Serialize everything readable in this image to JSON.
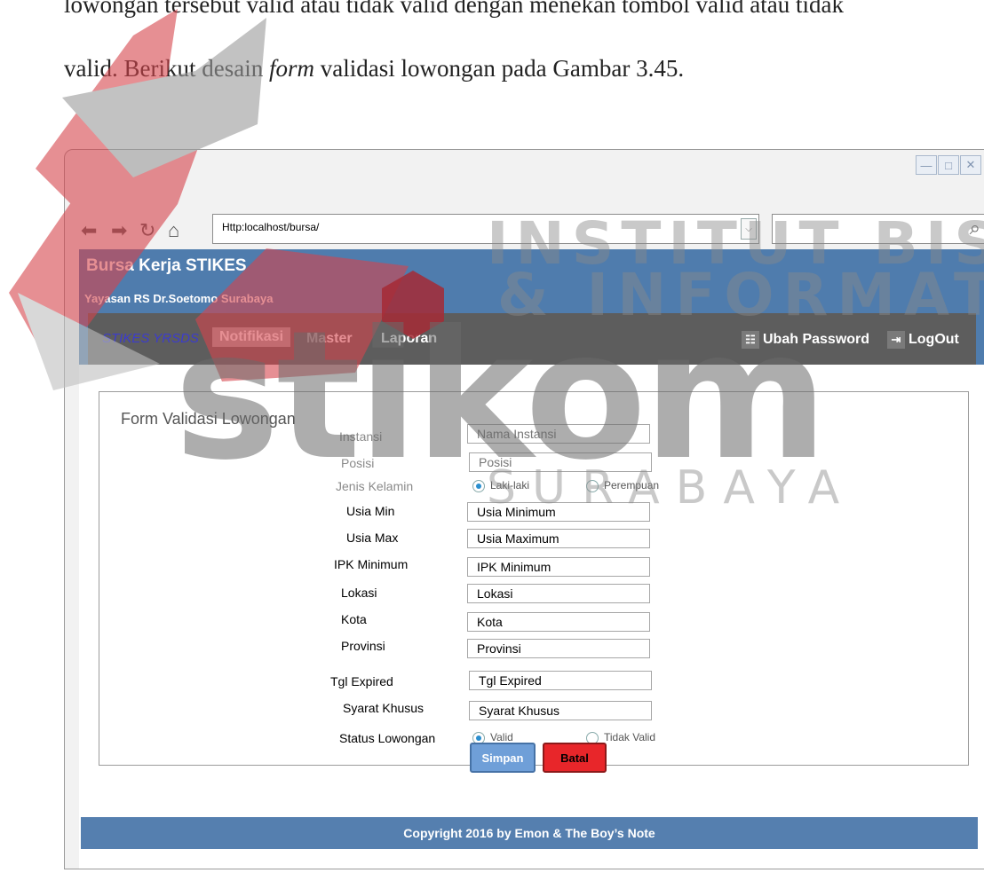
{
  "document": {
    "line1": "lowongan tersebut valid atau tidak valid dengan menekan tombol valid atau tidak",
    "line2_before_italic": "valid. Berikut desain ",
    "line2_italic": "form",
    "line2_after_italic": " validasi lowongan pada Gambar 3.45."
  },
  "browser": {
    "address": "Http:localhost/bursa/",
    "controls": {
      "minimize": "—",
      "maximize": "□",
      "close": "✕"
    }
  },
  "app": {
    "title": "Bursa Kerja STIKES",
    "subtitle": "Yayasan RS Dr.Soetomo Surabaya",
    "menu": {
      "brand": "STIKES YRSDS",
      "items": [
        "Notifikasi",
        "Master",
        "Laporan"
      ],
      "change_password": "Ubah Password",
      "logout": "LogOut"
    }
  },
  "form": {
    "title": "Form Validasi Lowongan",
    "fields": [
      {
        "label": "Instansi",
        "value": "Nama Instansi"
      },
      {
        "label": "Posisi",
        "value": "Posisi"
      },
      {
        "label": "Usia Min",
        "value": "Usia Minimum"
      },
      {
        "label": "Usia Max",
        "value": "Usia Maximum"
      },
      {
        "label": "IPK Minimum",
        "value": "IPK Minimum"
      },
      {
        "label": "Lokasi",
        "value": "Lokasi"
      },
      {
        "label": "Kota",
        "value": "Kota"
      },
      {
        "label": "Provinsi",
        "value": "Provinsi"
      },
      {
        "label": "Tgl Expired",
        "value": "Tgl Expired"
      },
      {
        "label": "Syarat Khusus",
        "value": "Syarat Khusus"
      }
    ],
    "gender": {
      "label": "Jenis Kelamin",
      "options": [
        "Laki-laki",
        "Perempuan"
      ],
      "selected": "Laki-laki"
    },
    "status": {
      "label": "Status Lowongan",
      "options": [
        "Valid",
        "Tidak Valid"
      ],
      "selected": "Valid"
    },
    "save_label": "Simpan",
    "cancel_label": "Batal"
  },
  "footer": {
    "copyright": "Copyright 2016 by Emon & The Boy’s Note"
  },
  "watermark": {
    "line1": "INSTITUT BISNIS",
    "line2": "& INFORMATIKA",
    "logo_word": "stikom",
    "city": "SURABAYA",
    "colors": {
      "red": "#d6454d",
      "grey": "#6b6b6b",
      "light_grey": "#bfbfbf"
    }
  },
  "colors": {
    "header_blue": "#4f7cad",
    "menubar": "#5d5d5d",
    "save": "#6f9fd8",
    "cancel": "#e8262a"
  }
}
